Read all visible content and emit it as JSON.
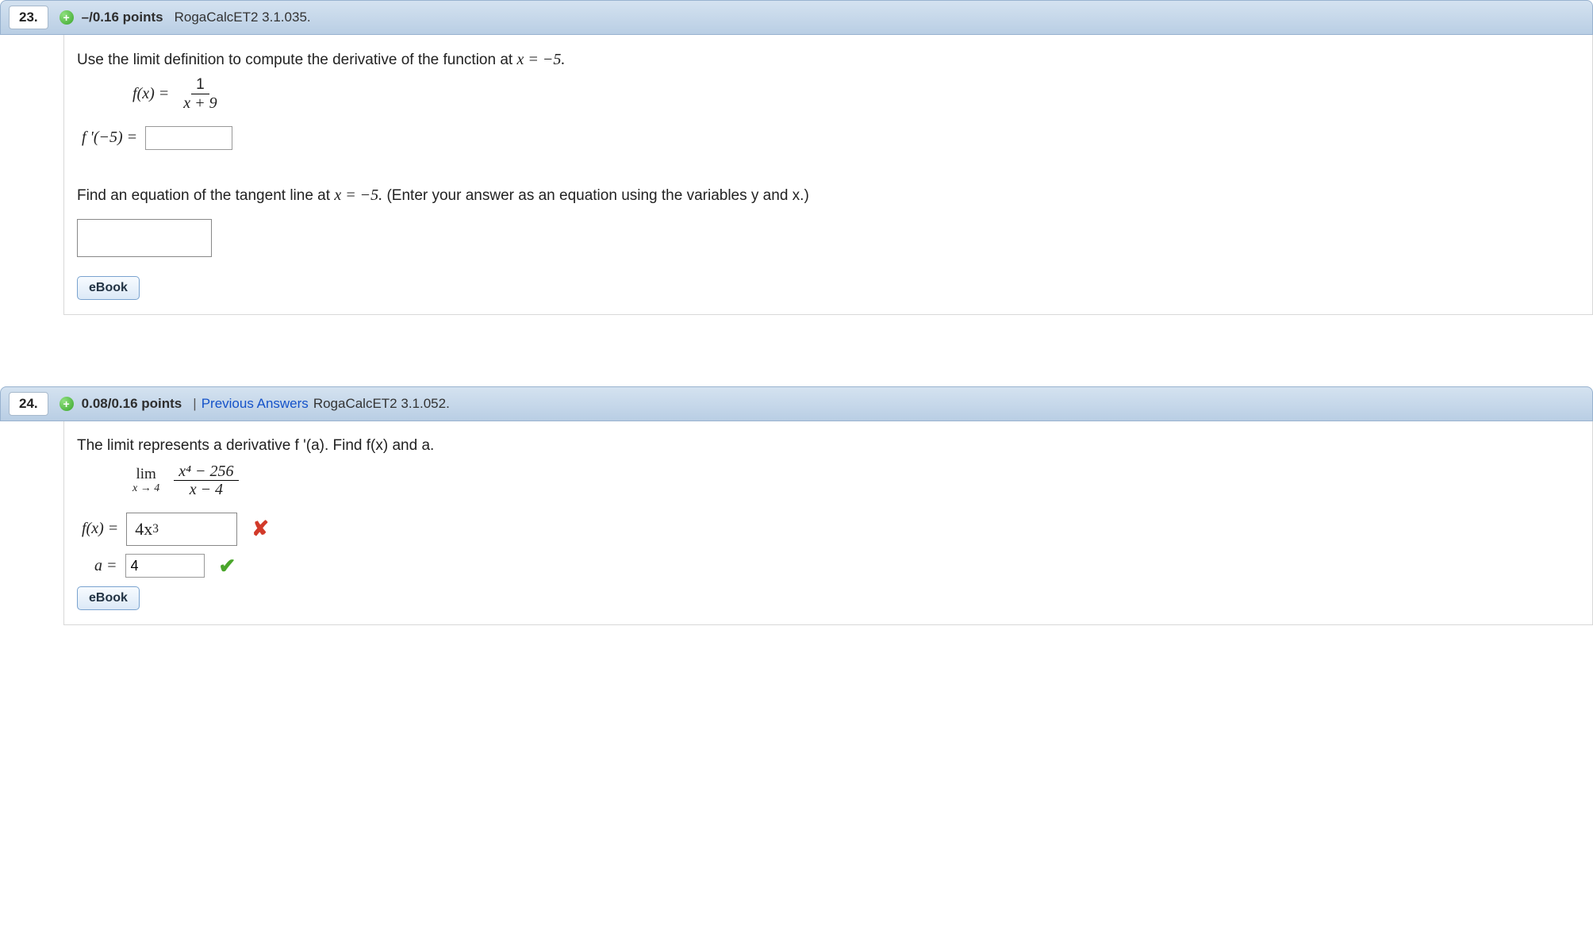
{
  "q23": {
    "number": "23.",
    "expand_symbol": "+",
    "points": "–/0.16 points",
    "assoc": "RogaCalcET2 3.1.035.",
    "instr_a": "Use the limit definition to compute the derivative of the function at ",
    "instr_a_x": "x = −5.",
    "func_lhs": "f(x) =",
    "frac_num": "1",
    "frac_den": "x + 9",
    "fprime_label": "f '(−5) =",
    "instr_b_pre": "Find an equation of the tangent line at ",
    "instr_b_x": "x = −5.",
    "instr_b_post": "  (Enter your answer as an equation using the variables y and x.)",
    "ebook": "eBook"
  },
  "q24": {
    "number": "24.",
    "expand_symbol": "+",
    "points": "0.08/0.16 points",
    "prev": "Previous Answers",
    "assoc": "RogaCalcET2 3.1.052.",
    "instr": "The limit represents a derivative f '(a). Find f(x) and a.",
    "lim_top": "lim",
    "lim_bot": "x → 4",
    "lim_num": "x⁴ − 256",
    "lim_den": "x − 4",
    "fx_label": "f(x) =",
    "fx_value": "4x",
    "fx_exp": "3",
    "a_label": "a =",
    "a_value": "4",
    "ebook": "eBook",
    "mark_wrong": "✘",
    "mark_right": "✔"
  }
}
